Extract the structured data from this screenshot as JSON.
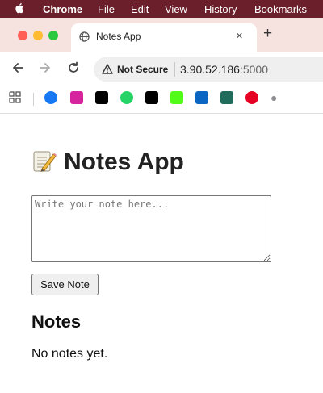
{
  "menubar": {
    "app": "Chrome",
    "items": [
      "File",
      "Edit",
      "View",
      "History",
      "Bookmarks"
    ]
  },
  "tab": {
    "title": "Notes App",
    "close": "×"
  },
  "newtab": "+",
  "address": {
    "security_label": "Not Secure",
    "host": "3.90.52.186",
    "port": ":5000"
  },
  "bookmarks": [
    {
      "name": "facebook-icon",
      "color": "#1877f2"
    },
    {
      "name": "instagram-icon",
      "color": "#d6249f"
    },
    {
      "name": "x-icon",
      "color": "#000000"
    },
    {
      "name": "whatsapp-icon",
      "color": "#25d366"
    },
    {
      "name": "tiktok-icon",
      "color": "#000000"
    },
    {
      "name": "kick-icon",
      "color": "#53fc18"
    },
    {
      "name": "linkedin-icon",
      "color": "#0a66c2"
    },
    {
      "name": "c-app-icon",
      "color": "#1f6b5c"
    },
    {
      "name": "pinterest-icon",
      "color": "#e60023"
    },
    {
      "name": "apple-icon",
      "color": "#8e8e93"
    }
  ],
  "page": {
    "title": "Notes App",
    "textarea_placeholder": "Write your note here...",
    "save_label": "Save Note",
    "notes_heading": "Notes",
    "empty_message": "No notes yet."
  }
}
